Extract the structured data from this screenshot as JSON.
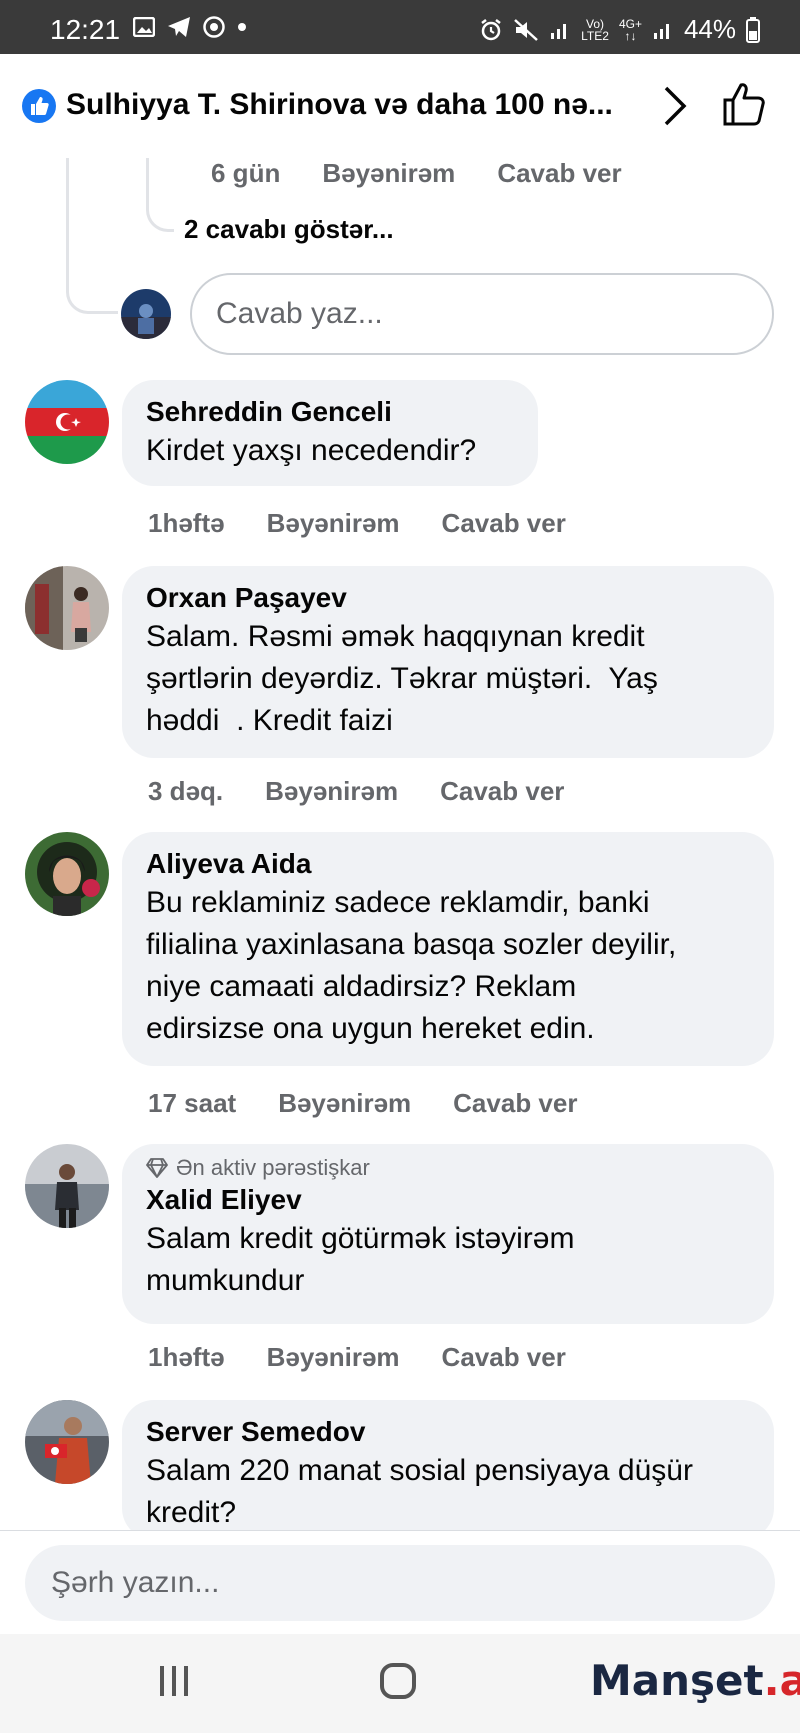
{
  "status_bar": {
    "time": "12:21",
    "battery": "44%",
    "network_top": "Vo)",
    "network_bottom": "LTE2",
    "network_4g": "4G+"
  },
  "header": {
    "title": "Sulhiyya T. Shirinova və daha 100 nə...",
    "accent_color": "#1877f2"
  },
  "previous_reply_meta": {
    "time": "6 gün",
    "like": "Bəyənirəm",
    "reply": "Cavab ver"
  },
  "show_replies": "2 cavabı göstər...",
  "reply_input": {
    "placeholder": "Cavab yaz..."
  },
  "comments": [
    {
      "name": "Sehreddin Genceli",
      "text": "Kirdet yaxşı necedendir?",
      "time": "1həftə",
      "like": "Bəyənirəm",
      "reply": "Cavab ver"
    },
    {
      "name": "Orxan Paşayev",
      "text": "Salam. Rəsmi əmək haqqıynan kredit\nşərtlərin deyərdiz. Təkrar müştəri.  Yaş\nhəddi  . Kredit faizi",
      "time": "3 dəq.",
      "like": "Bəyənirəm",
      "reply": "Cavab ver"
    },
    {
      "name": "Aliyeva Aida",
      "text": "Bu reklaminiz sadece reklamdir, banki\nfilialina yaxinlasana basqa sozler deyilir,\nniye camaati aldadirsiz? Reklam\nedirsizse ona uygun hereket edin.",
      "time": "17 saat",
      "like": "Bəyənirəm",
      "reply": "Cavab ver"
    },
    {
      "badge": "Ən aktiv pərəstişkar",
      "name": "Xalid Eliyev",
      "text": "Salam kredit götürmək istəyirəm\nmumkundur",
      "time": "1həftə",
      "like": "Bəyənirəm",
      "reply": "Cavab ver"
    },
    {
      "name": "Server Semedov",
      "text": "Salam 220 manat sosial pensiyaya düşür\nkredit?"
    }
  ],
  "composer": {
    "placeholder": "Şərh yazın..."
  },
  "watermark": {
    "text_dark": "Manşet",
    "text_red": ".az"
  }
}
